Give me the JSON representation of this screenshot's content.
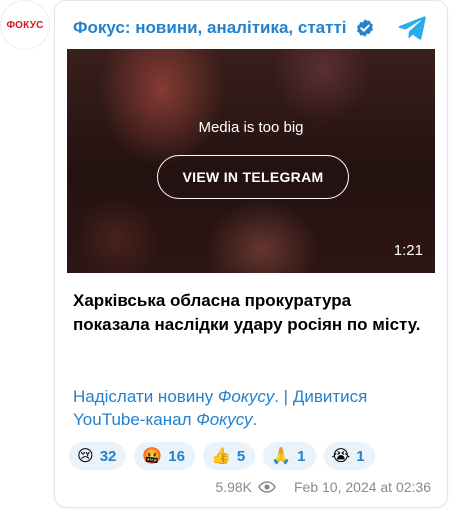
{
  "channel": {
    "avatar_text": "ФОКУС",
    "name": "Фокус: новини, аналітика, статті",
    "verified_icon": "verified-badge-icon",
    "share_icon": "telegram-share-icon",
    "accent_color": "#2481cc"
  },
  "media": {
    "message": "Media is too big",
    "button_label": "VIEW IN TELEGRAM",
    "duration": "1:21"
  },
  "post": {
    "text": "Харківська обласна прокуратура показала наслідки удару росіян по місту."
  },
  "links": {
    "send_news": "Надіслати новину ",
    "send_news_italic": "Фокусу",
    "separator": ". | ",
    "watch": "Дивитися YouTube-канал ",
    "watch_italic": "Фокусу",
    "end": "."
  },
  "reactions": [
    {
      "emoji": "😢",
      "icon": "crying-face-icon",
      "count": "32"
    },
    {
      "emoji": "🤬",
      "icon": "angry-face-icon",
      "count": "16"
    },
    {
      "emoji": "👍",
      "icon": "thumbs-up-icon",
      "count": "5"
    },
    {
      "emoji": "🙏",
      "icon": "praying-hands-icon",
      "count": "1"
    },
    {
      "emoji": "😭",
      "icon": "loudly-crying-face-icon",
      "count": "1"
    }
  ],
  "footer": {
    "views": "5.98K",
    "view_icon": "eye-icon",
    "date": "Feb 10, 2024 at 02:36"
  }
}
